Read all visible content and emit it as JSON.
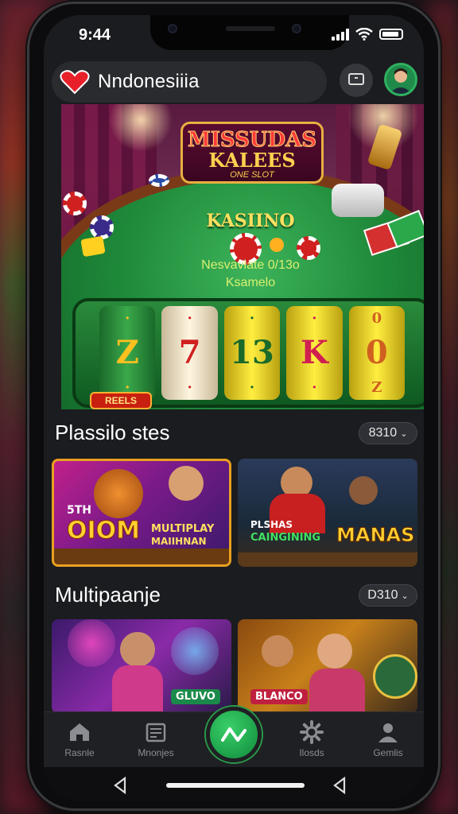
{
  "status": {
    "time": "9:44"
  },
  "header": {
    "brand": "Nndonesiiia"
  },
  "hero": {
    "logo_line1": "MISSUDAS",
    "logo_line2": "KALEES",
    "logo_line3": "ONE SLOT",
    "table_title": "KASIINO",
    "subtitle1": "Nesvaviate 0/13o",
    "subtitle2": "Ksamelo",
    "reels": [
      [
        "Z",
        "7",
        "·"
      ],
      [
        "7",
        "7",
        "·"
      ],
      [
        "13",
        "·"
      ],
      [
        "K",
        "·"
      ],
      [
        "0",
        "Z"
      ]
    ],
    "badge": "REELS"
  },
  "section1": {
    "title": "Plassilo stes",
    "pill": "8310",
    "cards": [
      {
        "line1": "5TH",
        "line2": "OIOM",
        "line3": "MULTIPLAY",
        "line4": "MAIIHNAN"
      },
      {
        "line1": "PLSHAS",
        "line2": "CAINGINING",
        "line3": "MANAS"
      }
    ]
  },
  "section2": {
    "title": "Multipaanje",
    "pill": "D310",
    "cards": [
      {
        "line1": "GLUVO"
      },
      {
        "line1": "BLANCO"
      }
    ]
  },
  "nav": {
    "items": [
      {
        "label": "Rasnle",
        "icon": "home-icon"
      },
      {
        "label": "Mnonjes",
        "icon": "calendar-icon"
      },
      {
        "label": "Ilosds",
        "icon": "gear-icon"
      },
      {
        "label": "Gemlis",
        "icon": "profile-icon"
      }
    ]
  },
  "colors": {
    "accent": "#1fa84a",
    "background": "#1b1c1f",
    "text": "#ffffff"
  }
}
